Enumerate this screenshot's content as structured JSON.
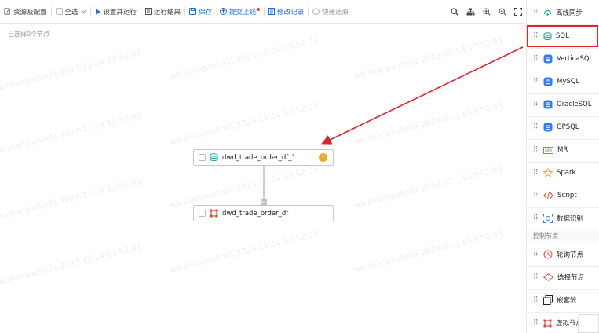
{
  "toolbar": {
    "resources_config": "资源及配置",
    "select_all": "全选",
    "set_and_run": "设置并运行",
    "run_result": "运行结果",
    "save": "保存",
    "submit_online": "提交上线",
    "modify_log": "修改记录",
    "quick_restore": "快速还原"
  },
  "canvas": {
    "selection_info": "已选择0个节点",
    "watermark": "wb.shangaolin01 2023-11-14 13:52:03",
    "nodes": [
      {
        "label": "dwd_trade_order_df_1",
        "type": "sql",
        "warning": "!"
      },
      {
        "label": "dwd_trade_order_df",
        "type": "virtual"
      }
    ]
  },
  "panel": {
    "items": [
      {
        "label": "离线同步",
        "icon": "offline-sync-icon"
      },
      {
        "label": "SQL",
        "icon": "sql-icon"
      },
      {
        "label": "VerticaSQL",
        "icon": "database-icon"
      },
      {
        "label": "MySQL",
        "icon": "database-icon"
      },
      {
        "label": "OracleSQL",
        "icon": "database-icon"
      },
      {
        "label": "GPSQL",
        "icon": "database-icon"
      },
      {
        "label": "MR",
        "icon": "mr-icon"
      },
      {
        "label": "Spark",
        "icon": "star-icon"
      },
      {
        "label": "Script",
        "icon": "code-icon"
      },
      {
        "label": "数据识别",
        "icon": "scan-icon"
      }
    ],
    "section_title": "控制节点",
    "control_items": [
      {
        "label": "轮询节点",
        "icon": "poll-icon"
      },
      {
        "label": "选择节点",
        "icon": "diamond-icon"
      },
      {
        "label": "嵌套流",
        "icon": "nested-icon"
      },
      {
        "label": "虚拟节点",
        "icon": "virtual-icon"
      }
    ]
  },
  "colors": {
    "accent": "#1d6ff2",
    "annotation_red": "#e0242b",
    "warning": "#f5a623"
  }
}
